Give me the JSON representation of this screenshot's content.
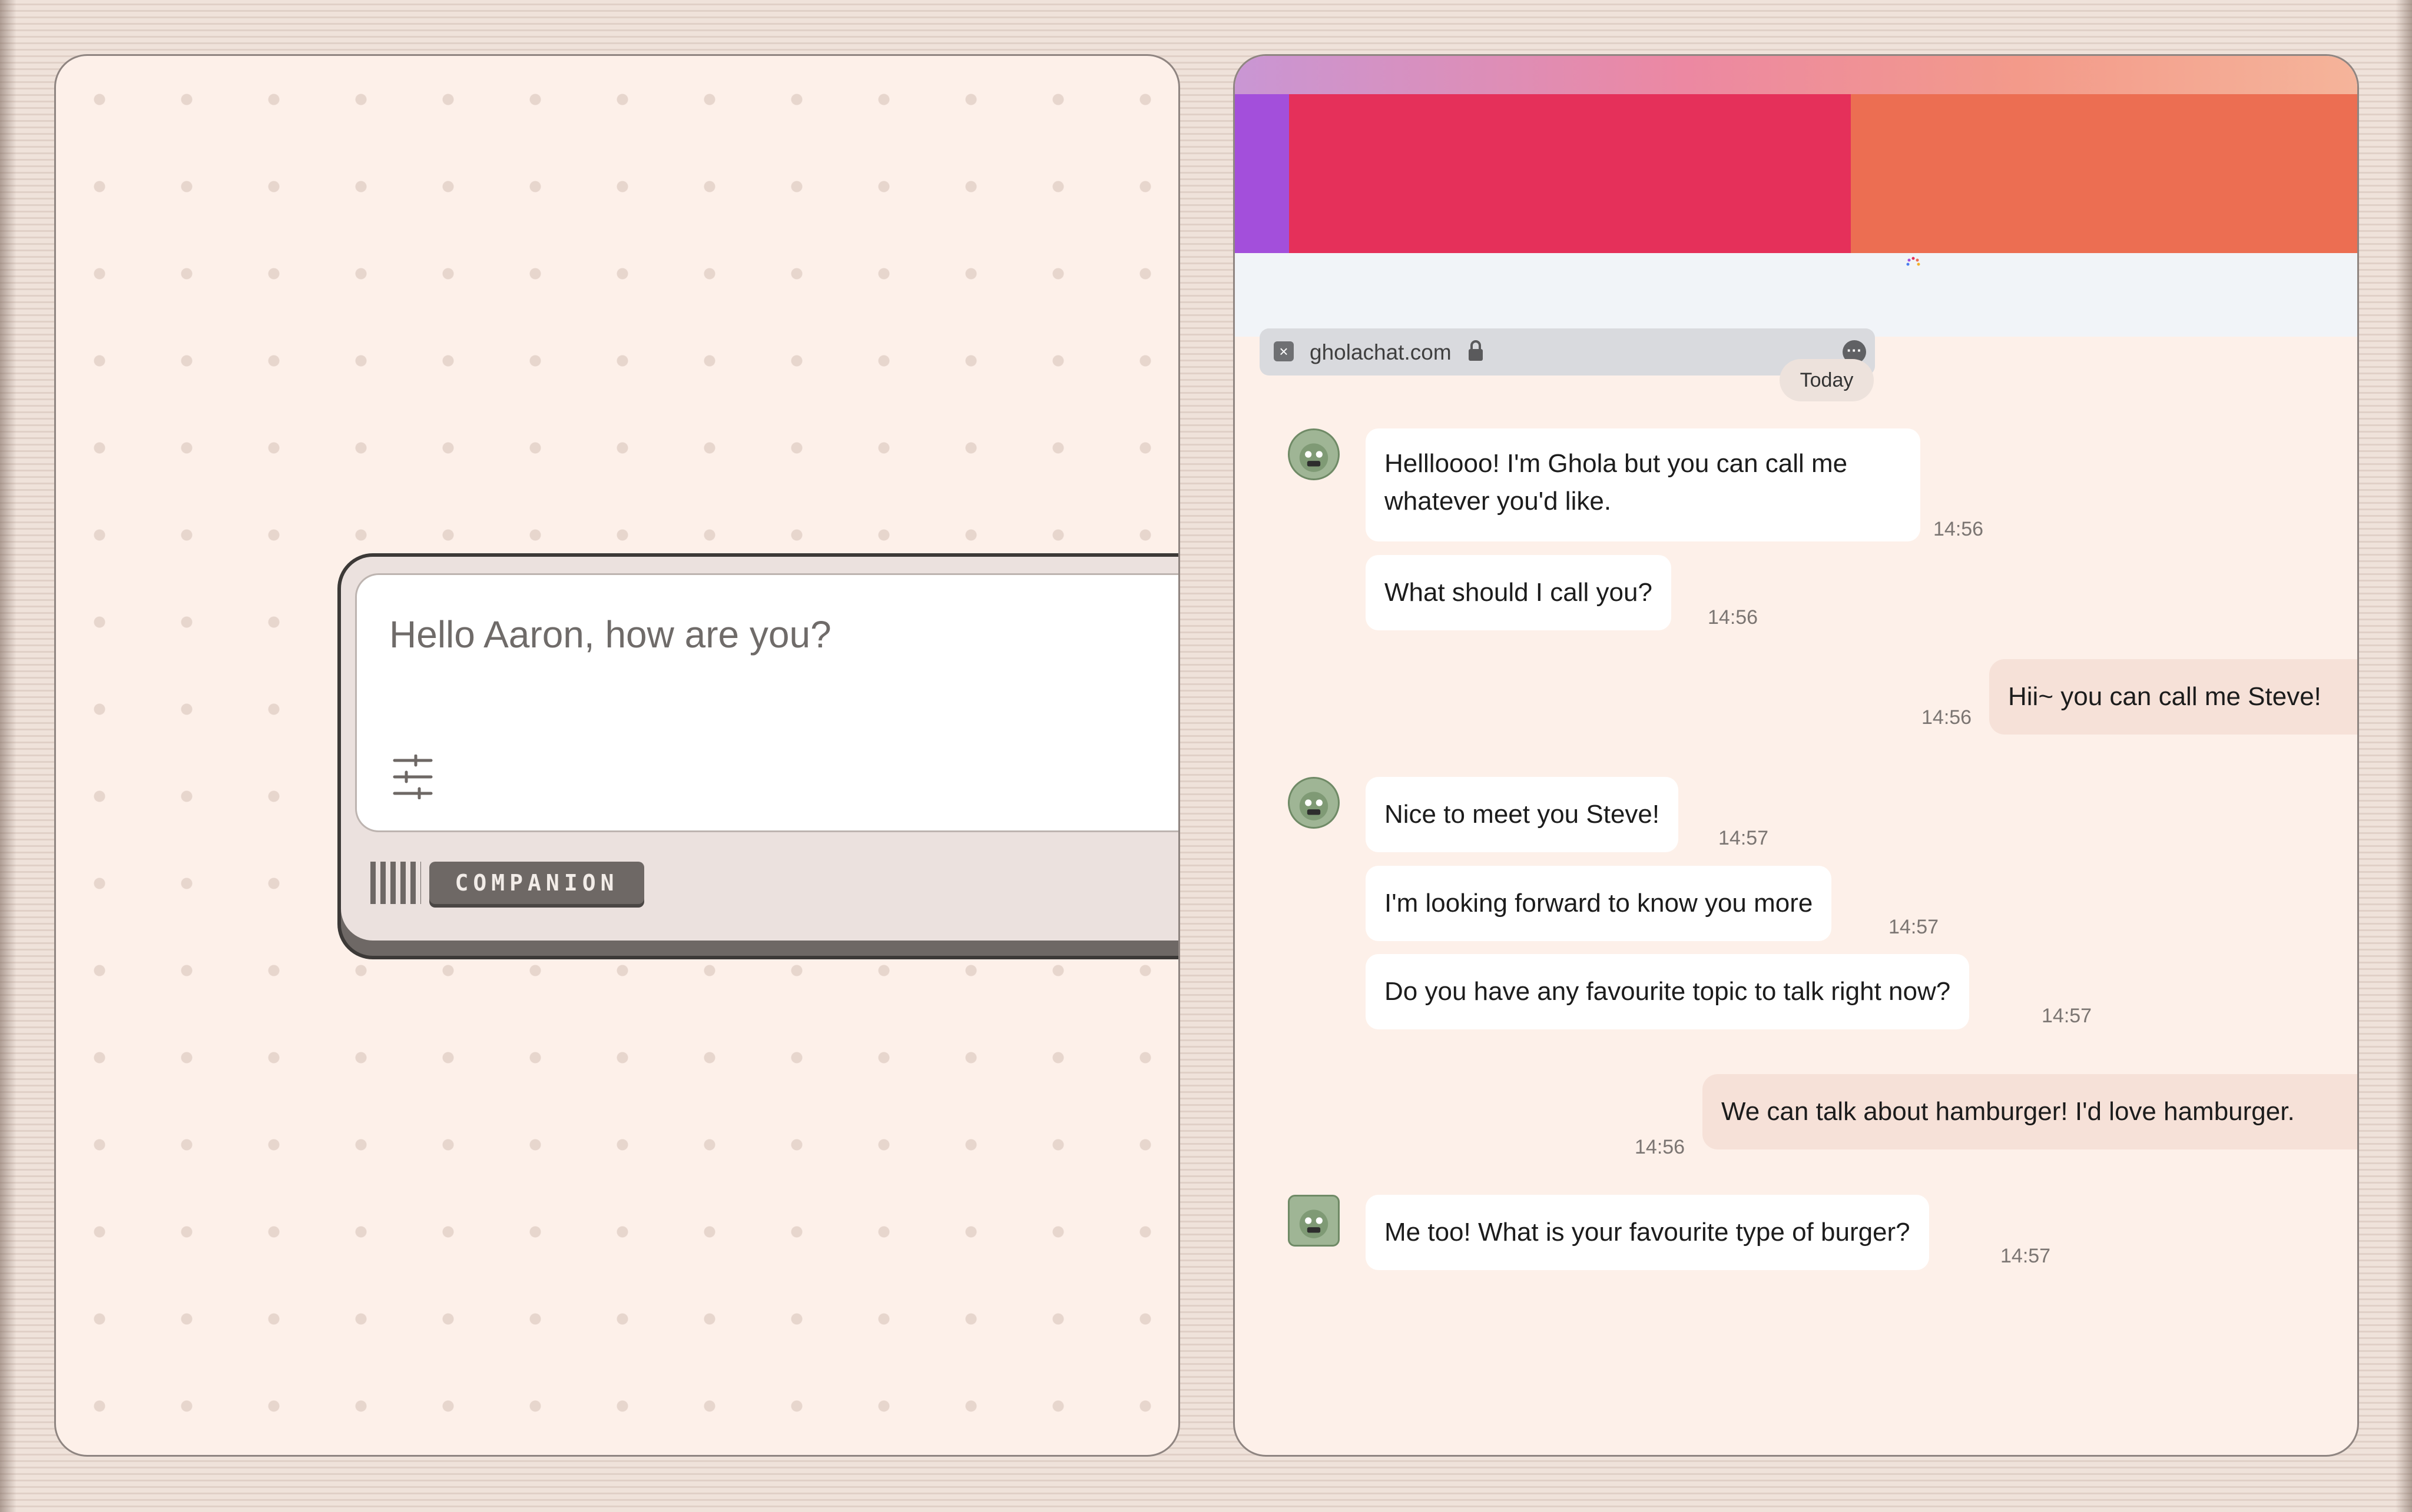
{
  "composer": {
    "placeholder": "Hello Aaron, how are you?",
    "mode_label": "COMPANION"
  },
  "browser": {
    "url": "gholachat.com",
    "close_icon": "close-icon",
    "lock_icon": "lock-icon",
    "more_icon": "more-options-icon"
  },
  "chat": {
    "day_label": "Today",
    "messages": [
      {
        "side": "in",
        "text": "Hellloooo! I'm Ghola but you can call me whatever you'd like.",
        "time": "14:56"
      },
      {
        "side": "in",
        "text": "What should I call you?",
        "time": "14:56"
      },
      {
        "side": "out",
        "text": "Hii~ you can call me Steve!",
        "time": "14:56"
      },
      {
        "side": "in",
        "text": "Nice to meet you Steve!",
        "time": "14:57"
      },
      {
        "side": "in",
        "text": "I'm looking forward to know you more",
        "time": "14:57"
      },
      {
        "side": "in",
        "text": "Do you have any favourite topic to talk right now?",
        "time": "14:57"
      },
      {
        "side": "out",
        "text": "We can talk about hamburger! I'd love hamburger.",
        "time": "14:56"
      },
      {
        "side": "in",
        "text": "Me too! What is your favourite type of burger?",
        "time": "14:57"
      }
    ]
  },
  "colors": {
    "accent_purple": "#a34fdb",
    "accent_red": "#e5305a",
    "accent_orange": "#ec6e52",
    "panel_bg": "#fdf0e9",
    "outgoing_bubble": "#f6e1d8"
  }
}
